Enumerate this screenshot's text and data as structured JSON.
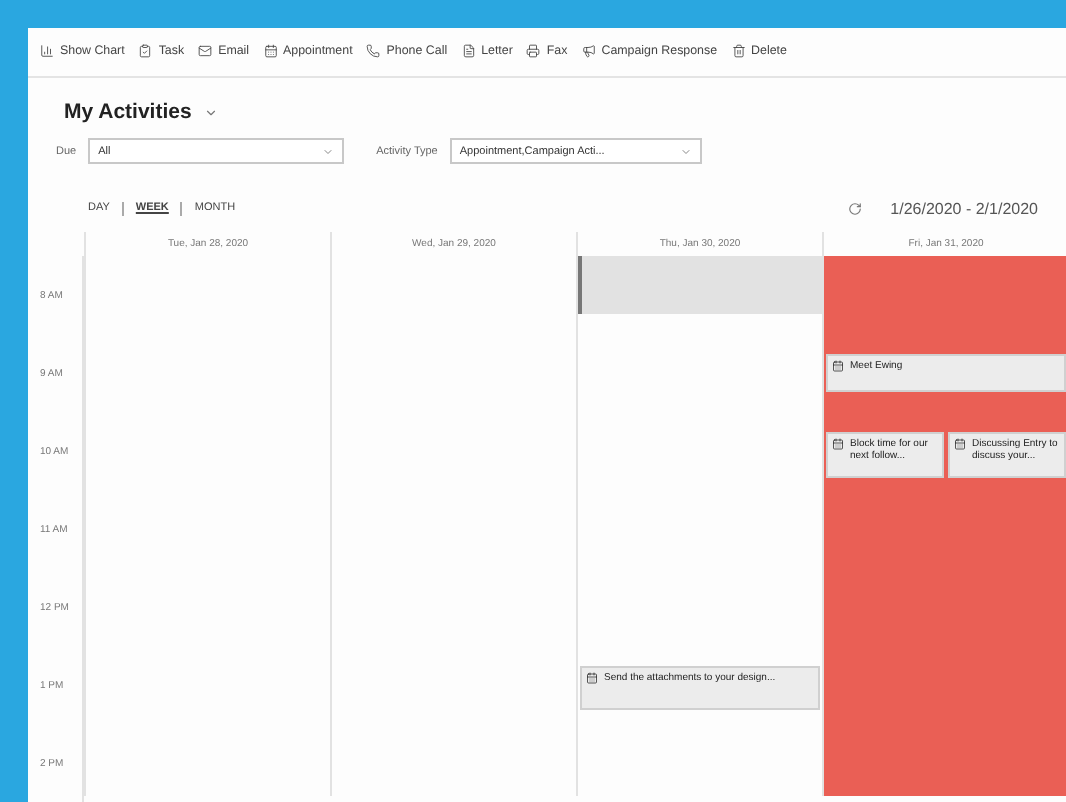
{
  "toolbar": [
    {
      "label": "Show Chart"
    },
    {
      "label": "Task"
    },
    {
      "label": "Email"
    },
    {
      "label": "Appointment"
    },
    {
      "label": "Phone Call"
    },
    {
      "label": "Letter"
    },
    {
      "label": "Fax"
    },
    {
      "label": "Campaign Response"
    },
    {
      "label": "Delete"
    }
  ],
  "title": "My Activities",
  "filters": [
    {
      "label": "Due",
      "value": "All"
    },
    {
      "label": "Activity Type",
      "value": "Appointment,Campaign Acti..."
    }
  ],
  "views": [
    {
      "label": "DAY",
      "selected": false
    },
    {
      "label": "WEEK",
      "selected": true
    },
    {
      "label": "MONTH",
      "selected": false
    }
  ],
  "date_range": "1/26/2020 - 2/1/2020",
  "hours": [
    "8 AM",
    "9 AM",
    "10 AM",
    "11 AM",
    "12 PM",
    "1 PM",
    "2 PM"
  ],
  "days": [
    {
      "header": "Tue, Jan 28, 2020"
    },
    {
      "header": "Wed, Jan 29, 2020"
    },
    {
      "header": "Thu, Jan 30, 2020",
      "events": [
        {
          "kind": "busy"
        },
        {
          "kind": "task",
          "title": "Send the attachments to your design..."
        }
      ]
    },
    {
      "header": "Fri, Jan 31, 2020",
      "events": [
        {
          "kind": "block"
        },
        {
          "kind": "task",
          "title": "Meet Ewing"
        },
        {
          "kind": "task",
          "title": "Block time for our next follow..."
        },
        {
          "kind": "task",
          "title": "Discussing Entry to discuss your..."
        }
      ]
    }
  ]
}
